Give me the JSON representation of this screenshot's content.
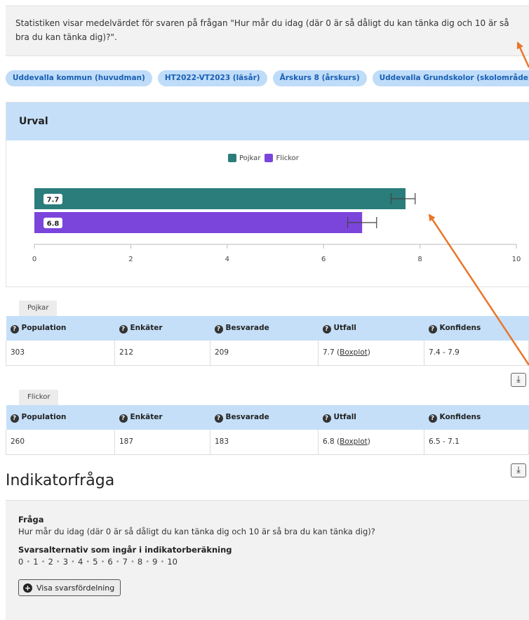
{
  "info": {
    "text": "Statistiken visar medelvärdet för svaren på frågan \"Hur mår du idag (där 0 är så dåligt du kan tänka dig och 10 är så bra du kan tänka dig)?\"."
  },
  "filters": [
    "Uddevalla kommun (huvudman)",
    "HT2022-VT2023 (läsår)",
    "Årskurs 8 (årskurs)",
    "Uddevalla Grundskolor (skolområde)"
  ],
  "card": {
    "title": "Urval"
  },
  "chart_data": {
    "type": "bar",
    "orientation": "horizontal",
    "series": [
      {
        "name": "Pojkar",
        "value": 7.7,
        "ci": [
          7.4,
          7.9
        ],
        "color": "#2a7d7b",
        "label": "7.7"
      },
      {
        "name": "Flickor",
        "value": 6.8,
        "ci": [
          6.5,
          7.1
        ],
        "color": "#7b45db",
        "label": "6.8"
      }
    ],
    "xlim": [
      0,
      10
    ],
    "ticks": [
      "0",
      "2",
      "4",
      "6",
      "8",
      "10"
    ],
    "tick_values": [
      0,
      2,
      4,
      6,
      8,
      10
    ],
    "legend": "top-center"
  },
  "tables": [
    {
      "tab": "Pojkar",
      "headers": [
        "Population",
        "Enkäter",
        "Besvarade",
        "Utfall",
        "Konfidens"
      ],
      "row": {
        "population": "303",
        "enkater": "212",
        "besvarade": "209",
        "utfall": "7.7",
        "boxplot": "Boxplot",
        "konfidens": "7.4 - 7.9"
      }
    },
    {
      "tab": "Flickor",
      "headers": [
        "Population",
        "Enkäter",
        "Besvarade",
        "Utfall",
        "Konfidens"
      ],
      "row": {
        "population": "260",
        "enkater": "187",
        "besvarade": "183",
        "utfall": "6.8",
        "boxplot": "Boxplot",
        "konfidens": "6.5 - 7.1"
      }
    }
  ],
  "section": {
    "title": "Indikatorfråga",
    "question_label": "Fråga",
    "question_text": "Hur mår du idag (där 0 är så dåligt du kan tänka dig och 10 är så bra du kan tänka dig)?",
    "options_label": "Svarsalternativ som ingår i indikatorberäkning",
    "options": [
      "0",
      "1",
      "2",
      "3",
      "4",
      "5",
      "6",
      "7",
      "8",
      "9",
      "10"
    ],
    "show_button": "Visa svarsfördelning"
  },
  "colors": {
    "accent": "#1a5fb4",
    "header_bg": "#c5dff8",
    "arrow": "#e8762b"
  },
  "icons": {
    "help": "question-circle-icon",
    "download": "download-icon",
    "plus": "plus-circle-icon"
  }
}
